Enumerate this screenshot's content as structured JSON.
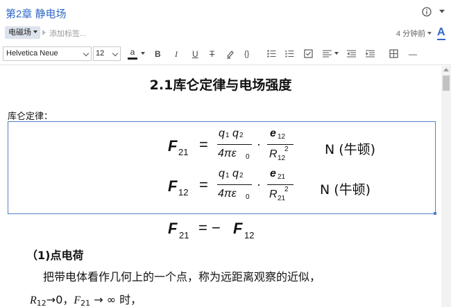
{
  "note": {
    "title": "第2章 静电场",
    "tag": "电磁场",
    "add_tag_placeholder": "添加标签...",
    "time_ago": "4 分钟前",
    "text_style_icon": "A"
  },
  "toolbar": {
    "font_family": "Helvetica Neue",
    "font_size": "12",
    "font_color_label": "a",
    "bold": "B",
    "italic": "I",
    "underline": "U",
    "strikethrough": "T",
    "code": "{}",
    "horizontal_rule": "—",
    "icons": [
      "bold-icon",
      "italic-icon",
      "underline-icon",
      "strikethrough-icon",
      "highlighter-icon",
      "code-icon",
      "bullet-list-icon",
      "numbered-list-icon",
      "checklist-icon",
      "align-icon",
      "outdent-icon",
      "indent-icon",
      "table-icon",
      "horizontal-rule-icon"
    ]
  },
  "content": {
    "heading": "2.1库仑定律与电场强度",
    "coulomb_label": "库仑定律：",
    "eq1": {
      "lhs": "F",
      "lhs_sub": "21",
      "eq": "=",
      "num_a": "q",
      "num_a_sub": "1",
      "num_b": "q",
      "num_b_sub": "2",
      "den": "4πε",
      "den_sub": "0",
      "dot": "·",
      "vec": "e",
      "vec_sub": "12",
      "r": "R",
      "r_sub": "12",
      "r_sup": "2",
      "unit": "N (牛顿)"
    },
    "eq2": {
      "lhs": "F",
      "lhs_sub": "12",
      "eq": "=",
      "num_a": "q",
      "num_a_sub": "1",
      "num_b": "q",
      "num_b_sub": "2",
      "den": "4πε",
      "den_sub": "0",
      "dot": "·",
      "vec": "e",
      "vec_sub": "21",
      "r": "R",
      "r_sub": "21",
      "r_sup": "2",
      "unit": "N (牛顿)"
    },
    "eq3": {
      "lhs": "F",
      "lhs_sub": "21",
      "eq": "= −",
      "rhs": "F",
      "rhs_sub": "12"
    },
    "section": "（1)点电荷",
    "paragraph": "把带电体看作几何上的一个点，称为远距离观察的近似，",
    "line3": {
      "r": "R",
      "r_sub": "12",
      "arrow_zero": "→0，",
      "f": "F",
      "f_sub": "21",
      "arrow_inf": " → ∞ 时，"
    }
  }
}
